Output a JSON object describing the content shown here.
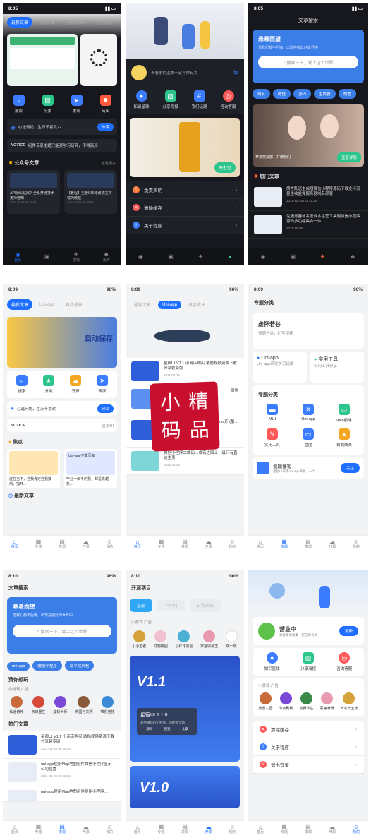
{
  "colors": {
    "accent": "#1e6fff",
    "dark": "#16181d",
    "light": "#f2f3f5",
    "stamp": "#c8102e"
  },
  "stamp": {
    "text": "小精码品"
  },
  "status": {
    "t1": "8:05",
    "t2": "8:09",
    "t3": "8:10",
    "batt": "96%"
  },
  "p1": {
    "tabs": [
      "最新文章",
      "全部文章",
      "小程序源码",
      "学习笔记"
    ],
    "icons": [
      "搜索",
      "分类",
      "发现",
      "商店"
    ],
    "notice": "心选何妨，生万千喜欢22",
    "share": "分享",
    "ticker": "组件专享主题只能资学习研究，不得商用",
    "sec": "公众号文章",
    "more": "查看更多",
    "a1": "API源码贴除外全系开通技术支持通知",
    "a1d": "2022-02-05 08:15:57",
    "a2": "【教程】王者IOS修改流言下载的教程",
    "a2d": "2022-02-21 08:25:58"
  },
  "p2": {
    "motto": "青春第的温柔一定与你有关",
    "icons": [
      "知识星球",
      "分享海报",
      "我们话题",
      "咨询客服"
    ],
    "banner": "去逛逛",
    "menu": [
      "免责声明",
      "清除缓存",
      "关于程序"
    ]
  },
  "p3": {
    "title": "文章搜索",
    "hero": "悬悬而望",
    "heroSub": "借我们都不后悔，出现在彼此的世界中",
    "search": "搜索一下，爱上这个世界",
    "pills": [
      "域名",
      "微信",
      "源码",
      "生成器",
      "胡言"
    ],
    "sec": "热门文章",
    "a1": "胡言乱语生成器微信小程序源码下载支持流量主收益免服务器域名部署",
    "a1d": "2021-10-26T21:15:24",
    "a2": "免服务器域名低成本运营工具箱微信小程序源码多功能集合一体",
    "a2d": "2021-10-08",
    "btn": "查看详情",
    "cap": "拿来交友群，并聊我们"
  },
  "p4": {
    "tabs": [
      "最新文章",
      "Uni-app",
      "自我成长"
    ],
    "hero": "自动保存",
    "icons": [
      "搜索",
      "分类",
      "开源",
      "商店"
    ],
    "notice": "心选何妨，生万千喜欢",
    "share": "分享",
    "ticker": "NOTICE",
    "tickerR": "星宿UI",
    "sec": "焦点",
    "sec2": "最新文章",
    "c1": "连在当下，自我肯定自我接纳，指开…",
    "c2": "毕业一年半的我，却是来越焦…",
    "c2tag": "Uni-app下载页面"
  },
  "p5": {
    "tabs": [
      "最新文章",
      "Uni-app",
      "自我成长"
    ],
    "a1": "星宿UI V1.1 小商店购买 激励视频资源下载 分享裂变版",
    "a1d": "2021-01-25",
    "a2": "组件",
    "a3": "ess开 (第…",
    "a4": "微信小程序二维码…或有进回上一级只有直达主页",
    "a4d": "2021-01-25"
  },
  "p6": {
    "title": "专题分类",
    "hero": "虚怀若谷",
    "heroSub": "专题分类，扩写视界",
    "c1": "Uni-app",
    "c1s": "Uni-app开发学习记录",
    "c2": "实用工具",
    "c2s": "实用工具分享",
    "sec": "专题分类",
    "items": [
      "MUI",
      "Uni-app",
      "web前端",
      "实用工具",
      "盘度",
      "自我成长"
    ],
    "blog": "枫瑞博客",
    "blogSub": "星宿UI采用uni-app开发，一个…",
    "follow": "关注"
  },
  "p7": {
    "title": "文章搜索",
    "hero": "悬悬而望",
    "heroSub": "借我们都不后悔，出现在彼此的世界中",
    "search": "搜索一下，爱上这个世界",
    "pills": [
      "uni-app",
      "微信小程序",
      "扁平化风格"
    ],
    "sec": "猜你想玩",
    "ad": "小游戏  广告",
    "games": [
      "仙途奇传",
      "末日重生",
      "旋转大师",
      "帝国与文明",
      "唯悦竞技"
    ],
    "sec2": "热门文章",
    "a1": "星宿UI V1.1 小商店购买 激励视频资源下载 分享裂变版",
    "a1d": "2021-01-25 08:28:59",
    "a2": "uni-app使用Map地图组件微信小程序显示公司位置",
    "a2d": "2021-01-25 08:22:26",
    "a3": "uni-app使用Map地图组件使用小程序…"
  },
  "p8": {
    "title": "开源项目",
    "tabs": [
      "全部",
      "Uni-app",
      "自我成长"
    ],
    "ad": "小游戏  广告",
    "games": [
      "小小王者",
      "动物拼图",
      "小红球冒险",
      "家居收纳王",
      "跳一跳"
    ],
    "cardTitle": "星宿UI 1.1.0",
    "cardSub": "高仿微信的小程序，功能很全面",
    "cardBtns": [
      "源码",
      "预览",
      "文章"
    ],
    "v2": "V1.0"
  },
  "p9": {
    "name": "营业中",
    "motto": "青春第的温柔一定与你有关",
    "renew": "更新",
    "icons": [
      "知识星球",
      "分享海报",
      "咨询客服"
    ],
    "ad": "小游戏  广告",
    "games": [
      "放置三国",
      "节奏刷刷",
      "荒野求生",
      "恶魔满场",
      "开心十五张"
    ],
    "menu": [
      "清除缓存",
      "关于程序",
      "退出登录"
    ]
  },
  "nav": {
    "p1": [
      "首页",
      "",
      "发现",
      "我的"
    ],
    "l": [
      "首页",
      "专题",
      "发现",
      "开源",
      "我的"
    ]
  }
}
